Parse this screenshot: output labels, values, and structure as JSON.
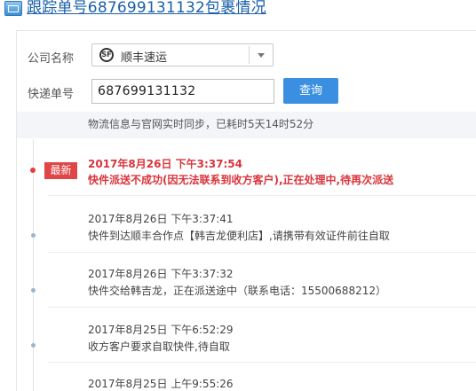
{
  "header": {
    "title": "跟踪单号687699131132包裹情况"
  },
  "form": {
    "company_label": "公司名称",
    "company_value": "顺丰速运",
    "company_icon": "sf-logo-icon",
    "company_icon_text": "SF",
    "number_label": "快递单号",
    "number_value": "687699131132",
    "query_button": "查询"
  },
  "sync_note": "物流信息与官网实时同步，已耗时5天14时52分",
  "latest_badge": "最新",
  "entries": [
    {
      "time": "2017年8月26日 下午3:37:54",
      "desc": "快件派送不成功(因无法联系到收方客户),正在处理中,待再次派送"
    },
    {
      "time": "2017年8月26日 下午3:37:41",
      "desc": "快件到达顺丰合作点【韩吉龙便利店】,请携带有效证件前往自取"
    },
    {
      "time": "2017年8月26日 下午3:37:32",
      "desc": "快件交给韩吉龙，正在派送途中（联系电话：15500688212）"
    },
    {
      "time": "2017年8月25日 下午6:52:29",
      "desc": "收方客户要求自取快件,待自取"
    },
    {
      "time": "2017年8月25日 上午9:55:26",
      "desc": ""
    }
  ],
  "colors": {
    "accent": "#3b8fe0",
    "latest": "#d9343b",
    "title": "#1a5fa8"
  }
}
